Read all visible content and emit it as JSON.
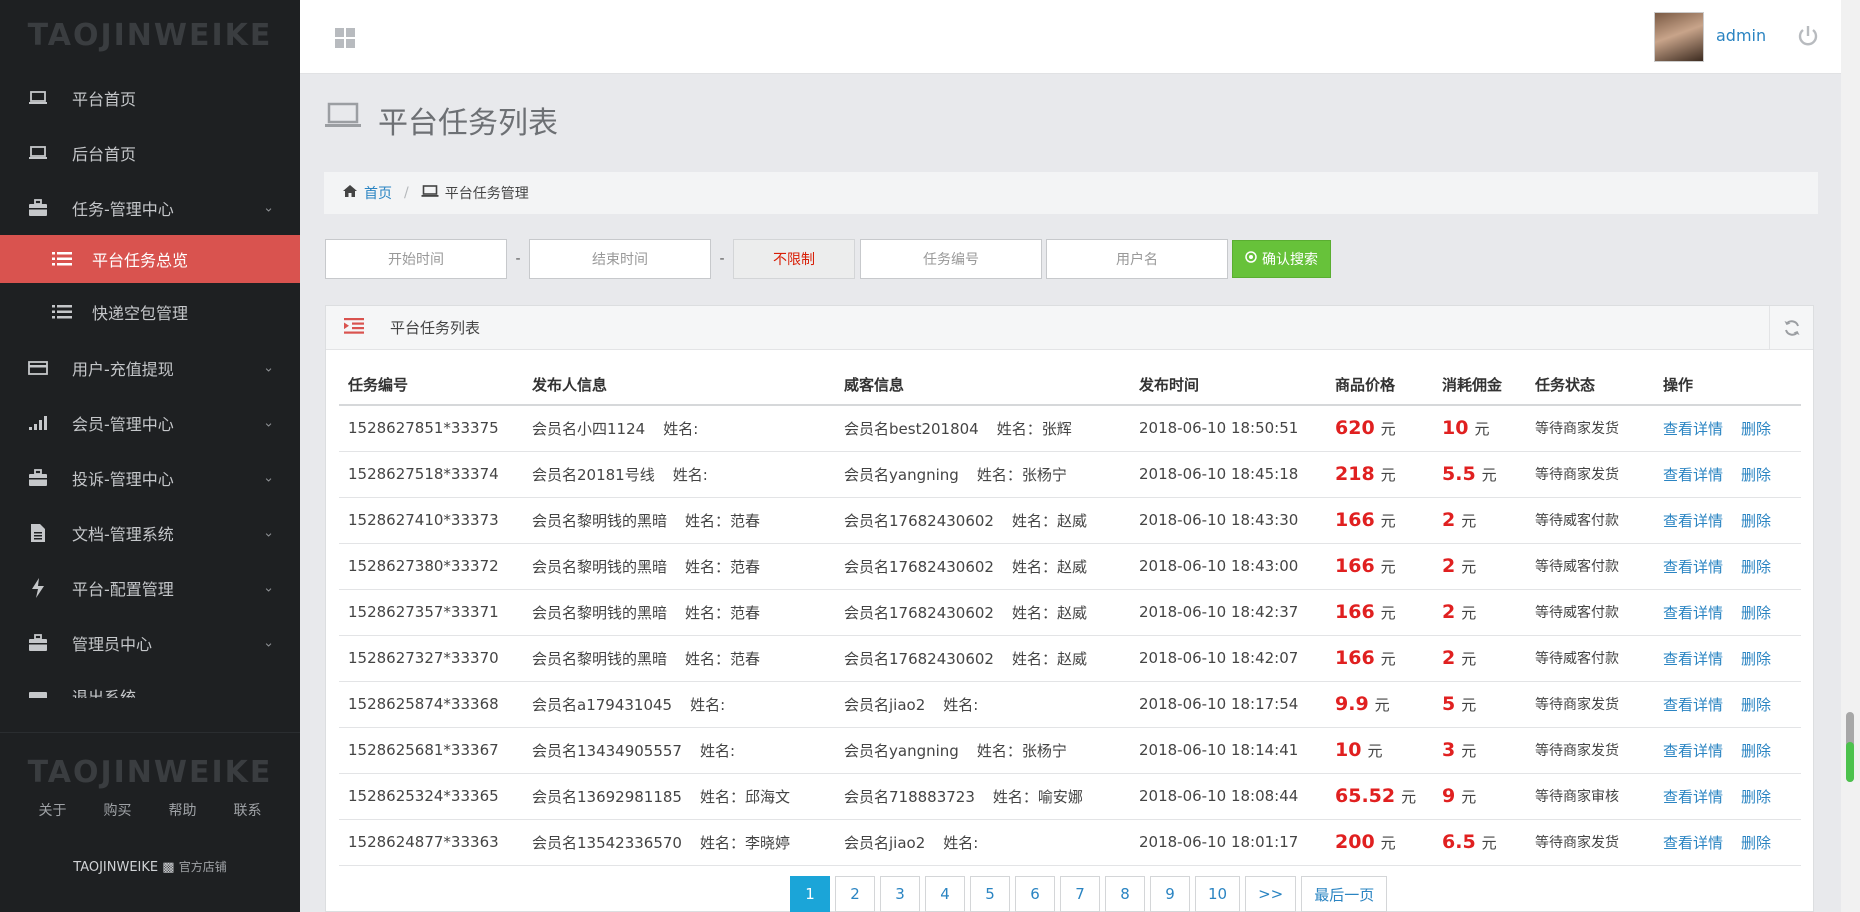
{
  "sidebar": {
    "brand": "TAOJINWEIKE",
    "items": [
      {
        "label": "平台首页"
      },
      {
        "label": "后台首页"
      },
      {
        "label": "任务-管理中心"
      }
    ],
    "subitems": [
      {
        "label": "平台任务总览"
      },
      {
        "label": "快递空包管理"
      }
    ],
    "items2": [
      {
        "label": "用户-充值提现"
      },
      {
        "label": "会员-管理中心"
      },
      {
        "label": "投诉-管理中心"
      },
      {
        "label": "文档-管理系统"
      },
      {
        "label": "平台-配置管理"
      },
      {
        "label": "管理员中心"
      },
      {
        "label": "退出系统"
      }
    ],
    "footer": {
      "brand": "TAOJINWEIKE",
      "links": [
        "关于",
        "购买",
        "帮助",
        "联系"
      ],
      "shop": "TAOJINWEIKE",
      "shop_sub": "官方店铺"
    }
  },
  "topbar": {
    "user": "admin"
  },
  "page": {
    "title": "平台任务列表",
    "breadcrumb": {
      "home": "首页",
      "current": "平台任务管理"
    }
  },
  "filters": {
    "start_placeholder": "开始时间",
    "end_placeholder": "结束时间",
    "dash": "-",
    "select_value": "不限制",
    "task_no_placeholder": "任务编号",
    "username_placeholder": "用户名",
    "search_label": "确认搜索"
  },
  "panel": {
    "title": "平台任务列表",
    "columns": [
      "任务编号",
      "发布人信息",
      "威客信息",
      "发布时间",
      "商品价格",
      "消耗佣金",
      "任务状态",
      "操作"
    ],
    "rows": [
      {
        "id": "1528627851*33375",
        "publisher": "会员名小四1124",
        "pub_name": "姓名:",
        "worker": "会员名best201804",
        "wk_name": "姓名：张辉",
        "time": "2018-06-10 18:50:51",
        "price": "620",
        "commission": "10",
        "status": "等待商家发货"
      },
      {
        "id": "1528627518*33374",
        "publisher": "会员名20181号线",
        "pub_name": "姓名:",
        "worker": "会员名yangning",
        "wk_name": "姓名：张杨宁",
        "time": "2018-06-10 18:45:18",
        "price": "218",
        "commission": "5.5",
        "status": "等待商家发货"
      },
      {
        "id": "1528627410*33373",
        "publisher": "会员名黎明钱的黑暗",
        "pub_name": "姓名：范春",
        "worker": "会员名17682430602",
        "wk_name": "姓名：赵威",
        "time": "2018-06-10 18:43:30",
        "price": "166",
        "commission": "2",
        "status": "等待威客付款"
      },
      {
        "id": "1528627380*33372",
        "publisher": "会员名黎明钱的黑暗",
        "pub_name": "姓名：范春",
        "worker": "会员名17682430602",
        "wk_name": "姓名：赵威",
        "time": "2018-06-10 18:43:00",
        "price": "166",
        "commission": "2",
        "status": "等待威客付款"
      },
      {
        "id": "1528627357*33371",
        "publisher": "会员名黎明钱的黑暗",
        "pub_name": "姓名：范春",
        "worker": "会员名17682430602",
        "wk_name": "姓名：赵威",
        "time": "2018-06-10 18:42:37",
        "price": "166",
        "commission": "2",
        "status": "等待威客付款"
      },
      {
        "id": "1528627327*33370",
        "publisher": "会员名黎明钱的黑暗",
        "pub_name": "姓名：范春",
        "worker": "会员名17682430602",
        "wk_name": "姓名：赵威",
        "time": "2018-06-10 18:42:07",
        "price": "166",
        "commission": "2",
        "status": "等待威客付款"
      },
      {
        "id": "1528625874*33368",
        "publisher": "会员名a179431045",
        "pub_name": "姓名:",
        "worker": "会员名jiao2",
        "wk_name": "姓名:",
        "time": "2018-06-10 18:17:54",
        "price": "9.9",
        "commission": "5",
        "status": "等待商家发货"
      },
      {
        "id": "1528625681*33367",
        "publisher": "会员名13434905557",
        "pub_name": "姓名:",
        "worker": "会员名yangning",
        "wk_name": "姓名：张杨宁",
        "time": "2018-06-10 18:14:41",
        "price": "10",
        "commission": "3",
        "status": "等待商家发货"
      },
      {
        "id": "1528625324*33365",
        "publisher": "会员名13692981185",
        "pub_name": "姓名：邱海文",
        "worker": "会员名718883723",
        "wk_name": "姓名：喻安娜",
        "time": "2018-06-10 18:08:44",
        "price": "65.52",
        "commission": "9",
        "status": "等待商家审核"
      },
      {
        "id": "1528624877*33363",
        "publisher": "会员名13542336570",
        "pub_name": "姓名：李晓婷",
        "worker": "会员名jiao2",
        "wk_name": "姓名:",
        "time": "2018-06-10 18:01:17",
        "price": "200",
        "commission": "6.5",
        "status": "等待商家发货"
      }
    ],
    "unit": "元",
    "actions": {
      "detail": "查看详情",
      "delete": "删除"
    }
  },
  "pagination": {
    "pages": [
      "1",
      "2",
      "3",
      "4",
      "5",
      "6",
      "7",
      "8",
      "9",
      "10",
      ">>",
      "最后一页"
    ],
    "active": "1"
  },
  "colors": {
    "accent": "#d9534f",
    "link": "#2a84c2",
    "price": "#e02020",
    "search": "#67c23a",
    "page_active": "#1ba5d8"
  }
}
